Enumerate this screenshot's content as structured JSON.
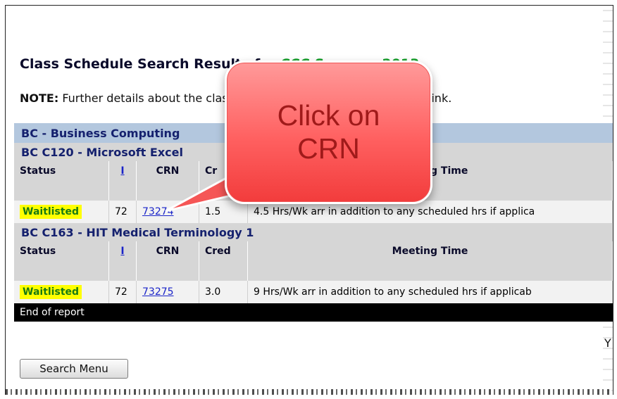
{
  "page": {
    "title_prefix": "Class Schedule Search Results for ",
    "title_term": "CCC Summer 2013",
    "note_label": "NOTE:",
    "note_text": " Further details about the class can be found by clicking the CRN link."
  },
  "subject": "BC - Business Computing",
  "courses": [
    {
      "title": "BC C120 - Microsoft Excel",
      "headers": {
        "status": "Status",
        "i": "I",
        "crn": "CRN",
        "cred": "Cr",
        "meeting": "Meeting Time"
      },
      "row": {
        "status": "Waitlisted",
        "i": "72",
        "crn": "73274",
        "cred": "1.5",
        "meeting": "4.5 Hrs/Wk arr in addition to any scheduled hrs if applica"
      }
    },
    {
      "title": "BC C163 - HIT Medical Terminology 1",
      "headers": {
        "status": "Status",
        "i": "I",
        "crn": "CRN",
        "cred": "Cred",
        "meeting": "Meeting Time"
      },
      "row": {
        "status": "Waitlisted",
        "i": "72",
        "crn": "73275",
        "cred": "3.0",
        "meeting": "9 Hrs/Wk arr in addition to any scheduled hrs if applicab"
      }
    }
  ],
  "end_of_report": "End of report",
  "trailing_text": "Y",
  "search_menu_button": "Search Menu",
  "callout": {
    "line1": "Click on",
    "line2": "CRN"
  },
  "colors": {
    "subject_bg": "#b3c7de",
    "course_bg": "#d6d6d6",
    "waitlisted_bg": "#ffff00",
    "term_green": "#18a12d",
    "callout_red": "#ff6060"
  }
}
